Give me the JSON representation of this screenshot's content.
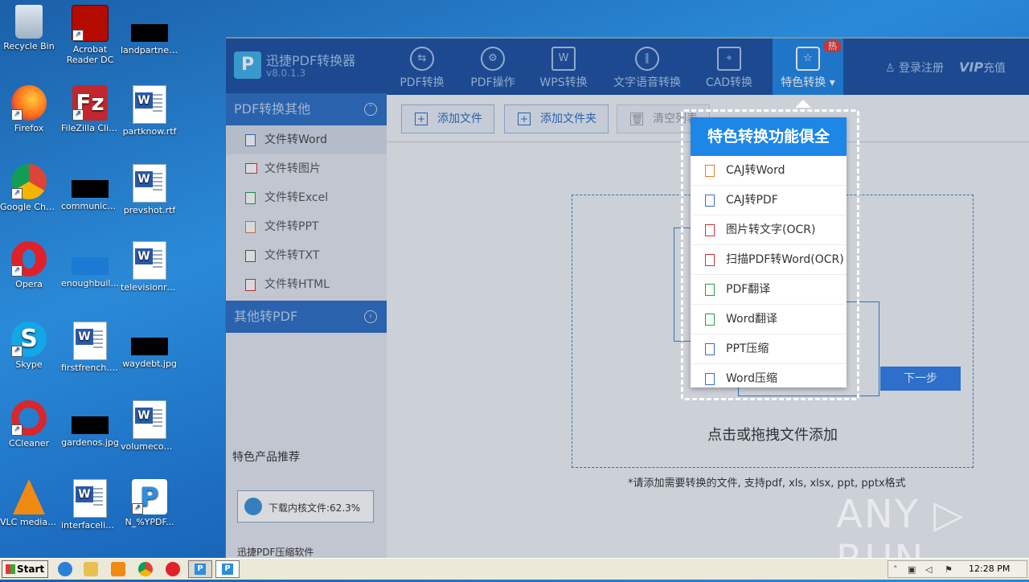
{
  "desktop": {
    "col1": [
      "Recycle Bin",
      "Firefox",
      "Google Chrome",
      "Opera",
      "Skype",
      "CCleaner",
      "VLC media player"
    ],
    "col2": [
      "Acrobat Reader DC",
      "FileZilla Client",
      "communicati...",
      "enoughbuil...",
      "firstfrench.rtf",
      "gardenos.jpg",
      "interfacelic.rtf"
    ],
    "col3": [
      "landpartner...",
      "partknow.rtf",
      "prevshot.rtf",
      "televisionrel...",
      "waydebt.jpg",
      "volumecom...",
      "N_%YPDF..."
    ]
  },
  "app": {
    "title": "迅捷PDF转换器",
    "version": "v8.0.1.3",
    "nav": [
      "PDF转换",
      "PDF操作",
      "WPS转换",
      "文字语音转换",
      "CAD转换",
      "特色转换"
    ],
    "hot_badge": "热",
    "login": "登录注册",
    "vip_label": "VIP",
    "vip_recharge": "充值"
  },
  "sidebar": {
    "group1": "PDF转换其他",
    "items": [
      "文件转Word",
      "文件转图片",
      "文件转Excel",
      "文件转PPT",
      "文件转TXT",
      "文件转HTML"
    ],
    "group2": "其他转PDF",
    "recommend": "特色产品推荐",
    "download_status": "下载内核文件:62.3%",
    "bottom_product": "迅捷PDF压缩软件"
  },
  "toolbar": {
    "add_file": "添加文件",
    "add_folder": "添加文件夹",
    "clear_list": "清空列表"
  },
  "main": {
    "drop_text": "点击或拖拽文件添加",
    "hint": "*请添加需要转换的文件, 支持pdf, xls, xlsx, ppt, pptx格式",
    "next_button": "下一步"
  },
  "dropdown": {
    "header": "特色转换功能俱全",
    "items": [
      "CAJ转Word",
      "CAJ转PDF",
      "图片转文字(OCR)",
      "扫描PDF转Word(OCR)",
      "PDF翻译",
      "Word翻译",
      "PPT压缩",
      "Word压缩"
    ]
  },
  "watermark": "ANY ▷ RUN",
  "taskbar": {
    "start": "Start",
    "clock": "12:28 PM"
  },
  "colors": {
    "app_header": "#1b4fa0",
    "active_nav": "#1e86e6",
    "accent": "#2f7de8"
  }
}
